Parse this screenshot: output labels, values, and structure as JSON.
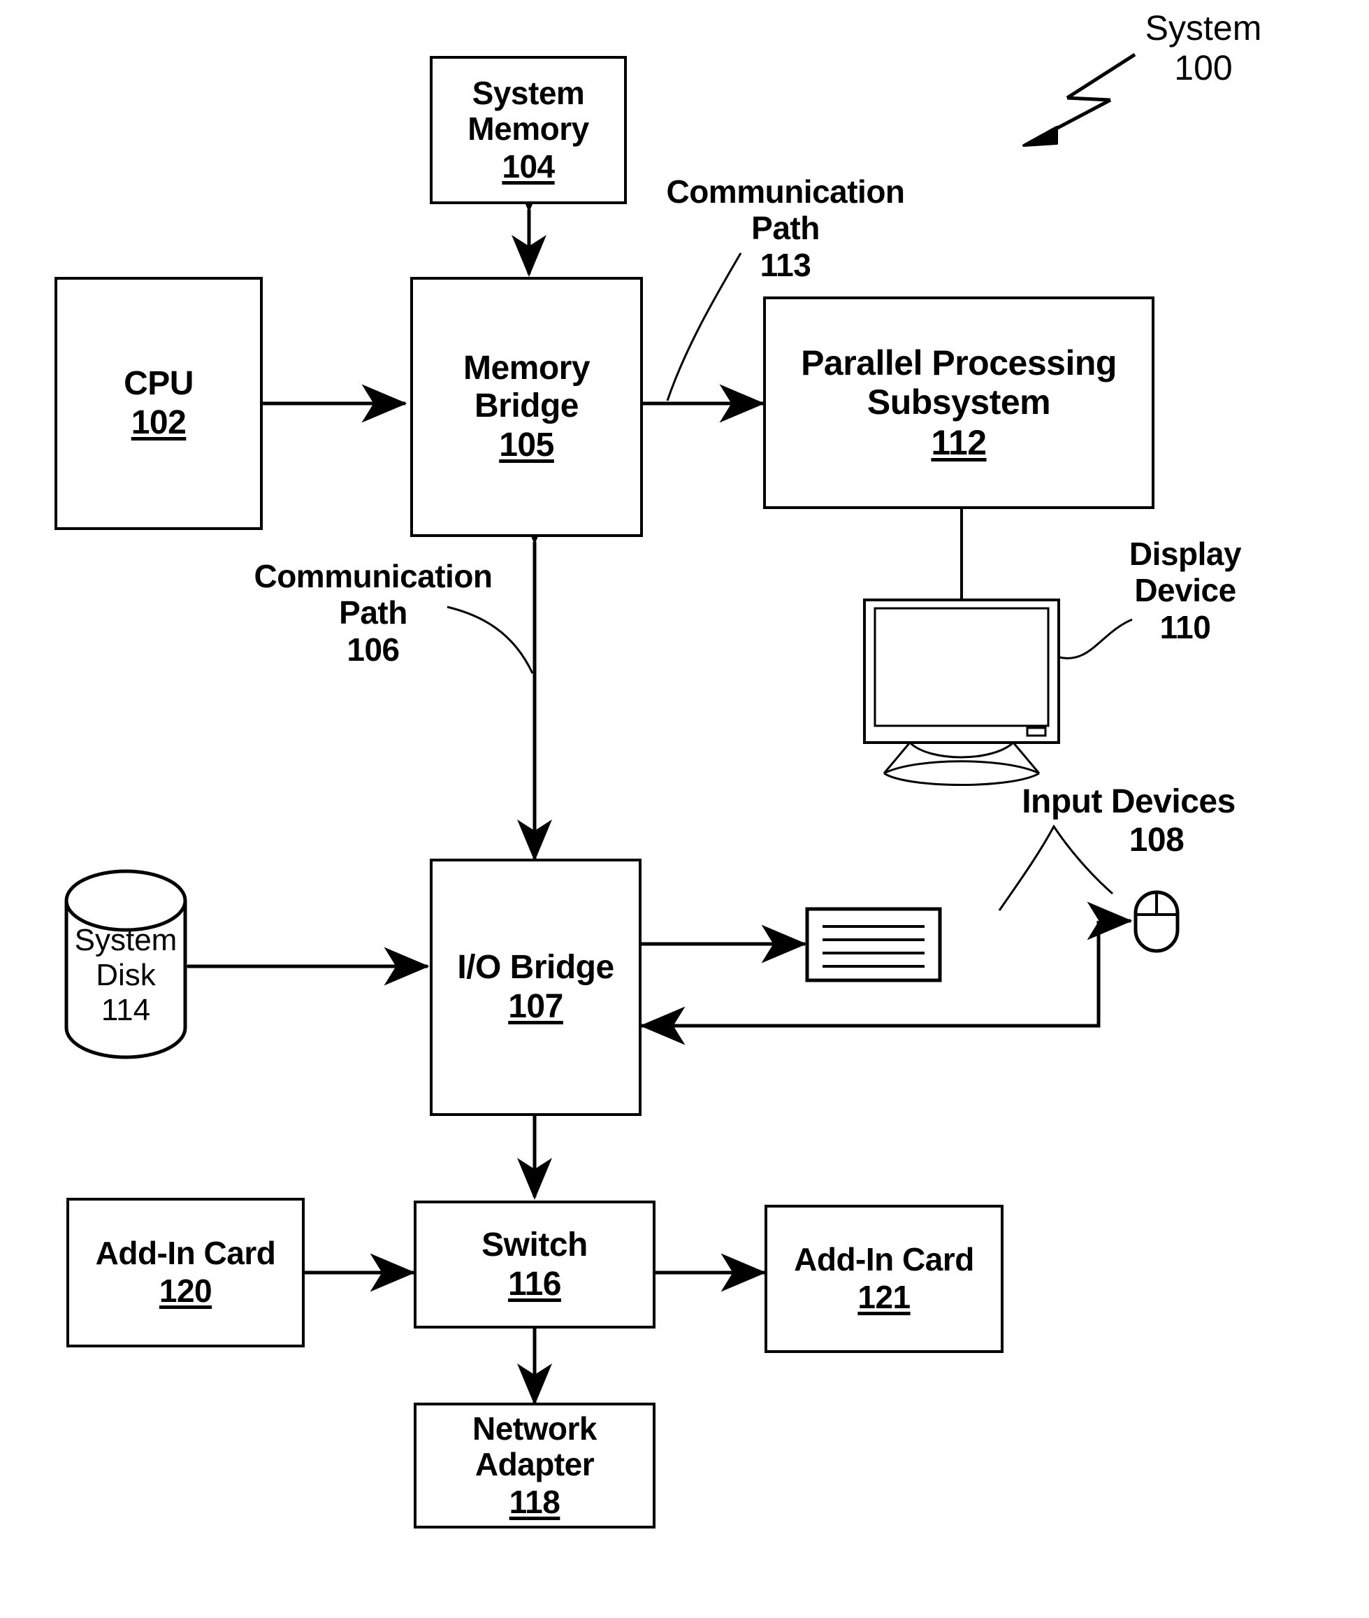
{
  "figure": {
    "kind": "patent-block-diagram",
    "system_callout": {
      "line1": "System",
      "line2": "100"
    }
  },
  "blocks": [
    {
      "id": "system-memory",
      "title_line1": "System",
      "title_line2": "Memory",
      "number": "104"
    },
    {
      "id": "cpu",
      "title_line1": "CPU",
      "title_line2": "",
      "number": "102"
    },
    {
      "id": "memory-bridge",
      "title_line1": "Memory",
      "title_line2": "Bridge",
      "number": "105"
    },
    {
      "id": "parallel-processing-subsystem",
      "title_line1": "Parallel Processing",
      "title_line2": "Subsystem",
      "number": "112"
    },
    {
      "id": "io-bridge",
      "title_line1": "I/O Bridge",
      "title_line2": "",
      "number": "107"
    },
    {
      "id": "system-disk",
      "title_line1": "System",
      "title_line2": "Disk",
      "number": "114"
    },
    {
      "id": "add-in-card-120",
      "title_line1": "Add-In Card",
      "title_line2": "",
      "number": "120"
    },
    {
      "id": "switch",
      "title_line1": "Switch",
      "title_line2": "",
      "number": "116"
    },
    {
      "id": "add-in-card-121",
      "title_line1": "Add-In Card",
      "title_line2": "",
      "number": "121"
    },
    {
      "id": "network-adapter",
      "title_line1": "Network",
      "title_line2": "Adapter",
      "number": "118"
    }
  ],
  "callouts": {
    "comm_path_113": {
      "line1": "Communication",
      "line2": "Path",
      "line3": "113"
    },
    "comm_path_106": {
      "line1": "Communication",
      "line2": "Path",
      "line3": "106"
    },
    "display_device": {
      "line1": "Display",
      "line2": "Device",
      "line3": "110"
    },
    "input_devices": {
      "line1": "Input Devices",
      "line2": "108"
    }
  },
  "colors": {
    "stroke": "#000000",
    "background": "#ffffff"
  }
}
